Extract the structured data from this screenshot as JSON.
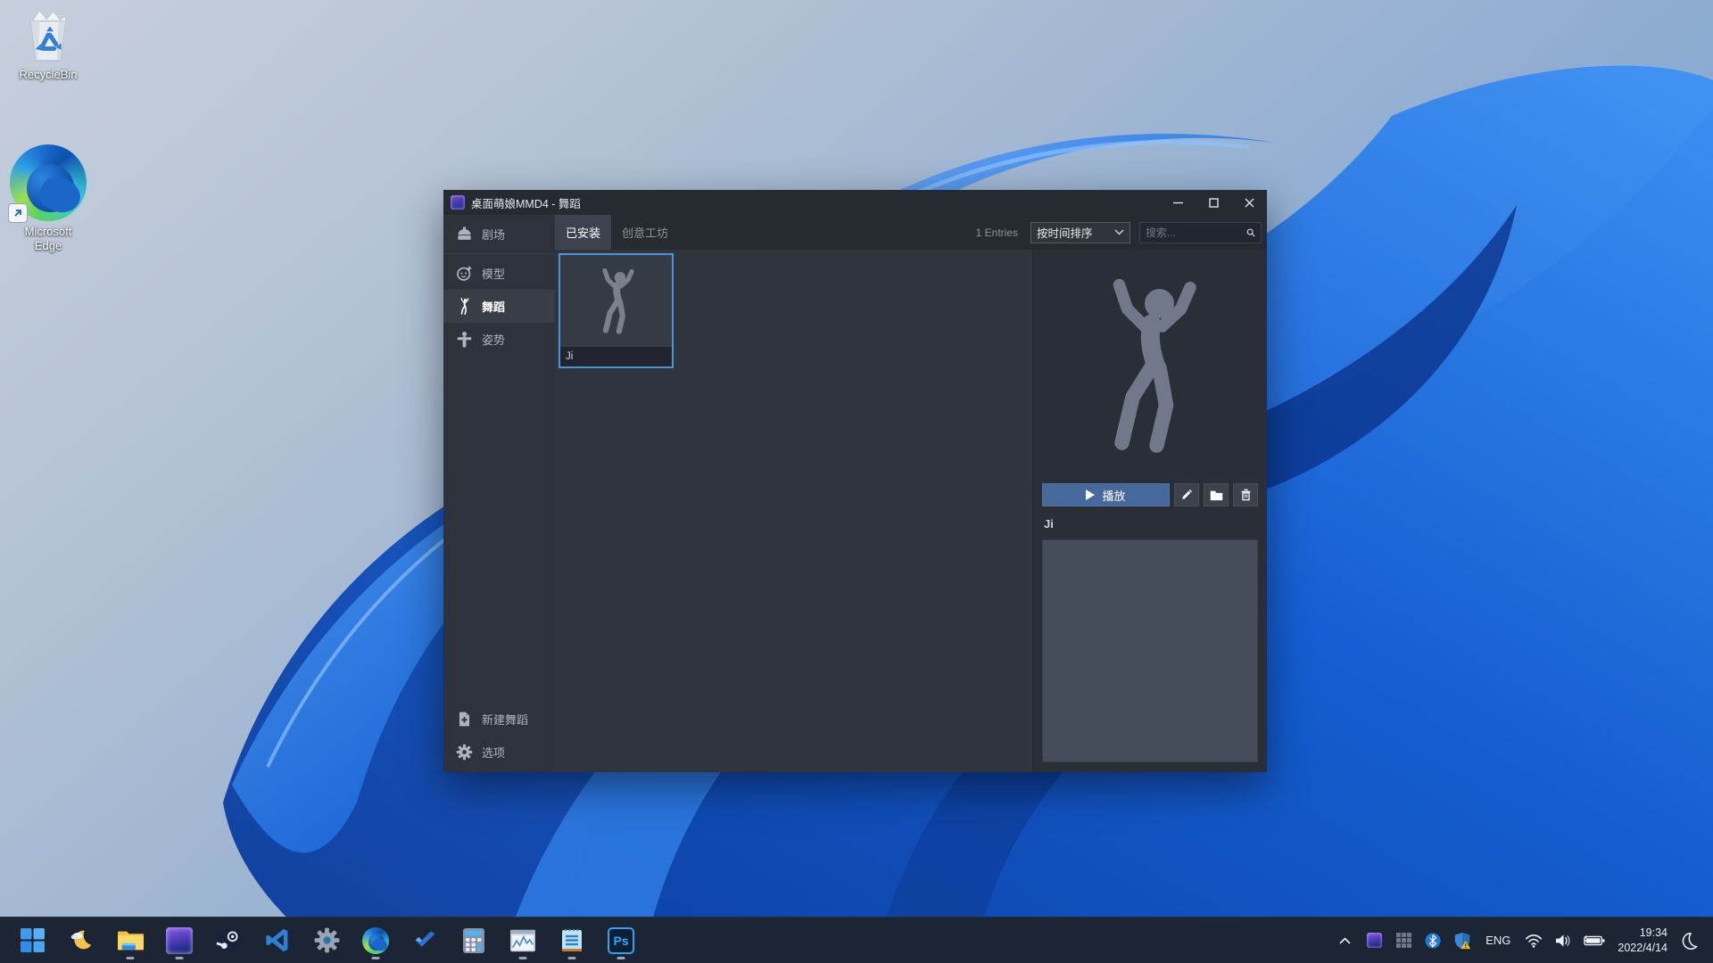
{
  "desktop": {
    "icons": [
      {
        "label": "RecycleBin"
      },
      {
        "label": "Microsoft Edge"
      }
    ]
  },
  "window": {
    "title": "桌面萌娘MMD4 - 舞蹈",
    "controls": {
      "minimize": "minimize",
      "maximize": "maximize",
      "close": "close"
    },
    "sidebar": {
      "items": [
        {
          "label": "剧场",
          "icon": "stage-icon",
          "active": false
        },
        {
          "label": "模型",
          "icon": "model-face-icon",
          "active": false
        },
        {
          "label": "舞蹈",
          "icon": "dance-icon",
          "active": true
        },
        {
          "label": "姿势",
          "icon": "pose-icon",
          "active": false
        }
      ],
      "bottom_items": [
        {
          "label": "新建舞蹈",
          "icon": "new-document-icon"
        },
        {
          "label": "选项",
          "icon": "gear-icon"
        }
      ]
    },
    "toolbar": {
      "tabs": [
        {
          "label": "已安装",
          "active": true
        },
        {
          "label": "创意工坊",
          "active": false
        }
      ],
      "entries_count": "1 Entries",
      "sort": {
        "selected": "按时间排序",
        "icon": "chevron-down-icon"
      },
      "search": {
        "placeholder": "搜索...",
        "value": "",
        "icon": "search-icon"
      }
    },
    "grid": {
      "items": [
        {
          "name": "Ji",
          "selected": true,
          "thumb": "dancing-figure"
        }
      ]
    },
    "detail_panel": {
      "preview": "dancing-figure",
      "play_label": "播放",
      "buttons": [
        "play-button",
        "edit-button",
        "open-folder-button",
        "delete-button"
      ],
      "item_name": "Ji",
      "description": ""
    },
    "colors": {
      "selection_blue": "#4a96dd",
      "play_button_blue": "#47689b",
      "window_bg": "#2b2f38",
      "sidebar_bg": "#2d323b",
      "panel_bg": "#2a2e37",
      "figure_gray": "#79818f"
    }
  },
  "taskbar": {
    "pinned": [
      {
        "name": "start",
        "running": false
      },
      {
        "name": "widgets-weather",
        "running": false
      },
      {
        "name": "file-explorer",
        "running": true
      },
      {
        "name": "mmd-app",
        "running": true
      },
      {
        "name": "steam",
        "running": false
      },
      {
        "name": "vscode",
        "running": false
      },
      {
        "name": "settings",
        "running": false
      },
      {
        "name": "edge",
        "running": true
      },
      {
        "name": "todo",
        "running": false
      },
      {
        "name": "calculator",
        "running": false
      },
      {
        "name": "task-manager",
        "running": true
      },
      {
        "name": "notepad",
        "running": true
      },
      {
        "name": "photoshop",
        "running": true
      }
    ],
    "photoshop_label": "Ps",
    "tray": {
      "icons": [
        "chevron-up-icon",
        "mmd-tray-icon",
        "app-grid-icon",
        "bluetooth-icon",
        "security-shield-icon",
        "wifi-icon",
        "volume-icon",
        "battery-icon",
        "moon-icon"
      ],
      "language": "ENG",
      "time": "19:34",
      "date": "2022/4/14"
    },
    "colors": {
      "taskbar_bg": "#1c2534"
    }
  }
}
